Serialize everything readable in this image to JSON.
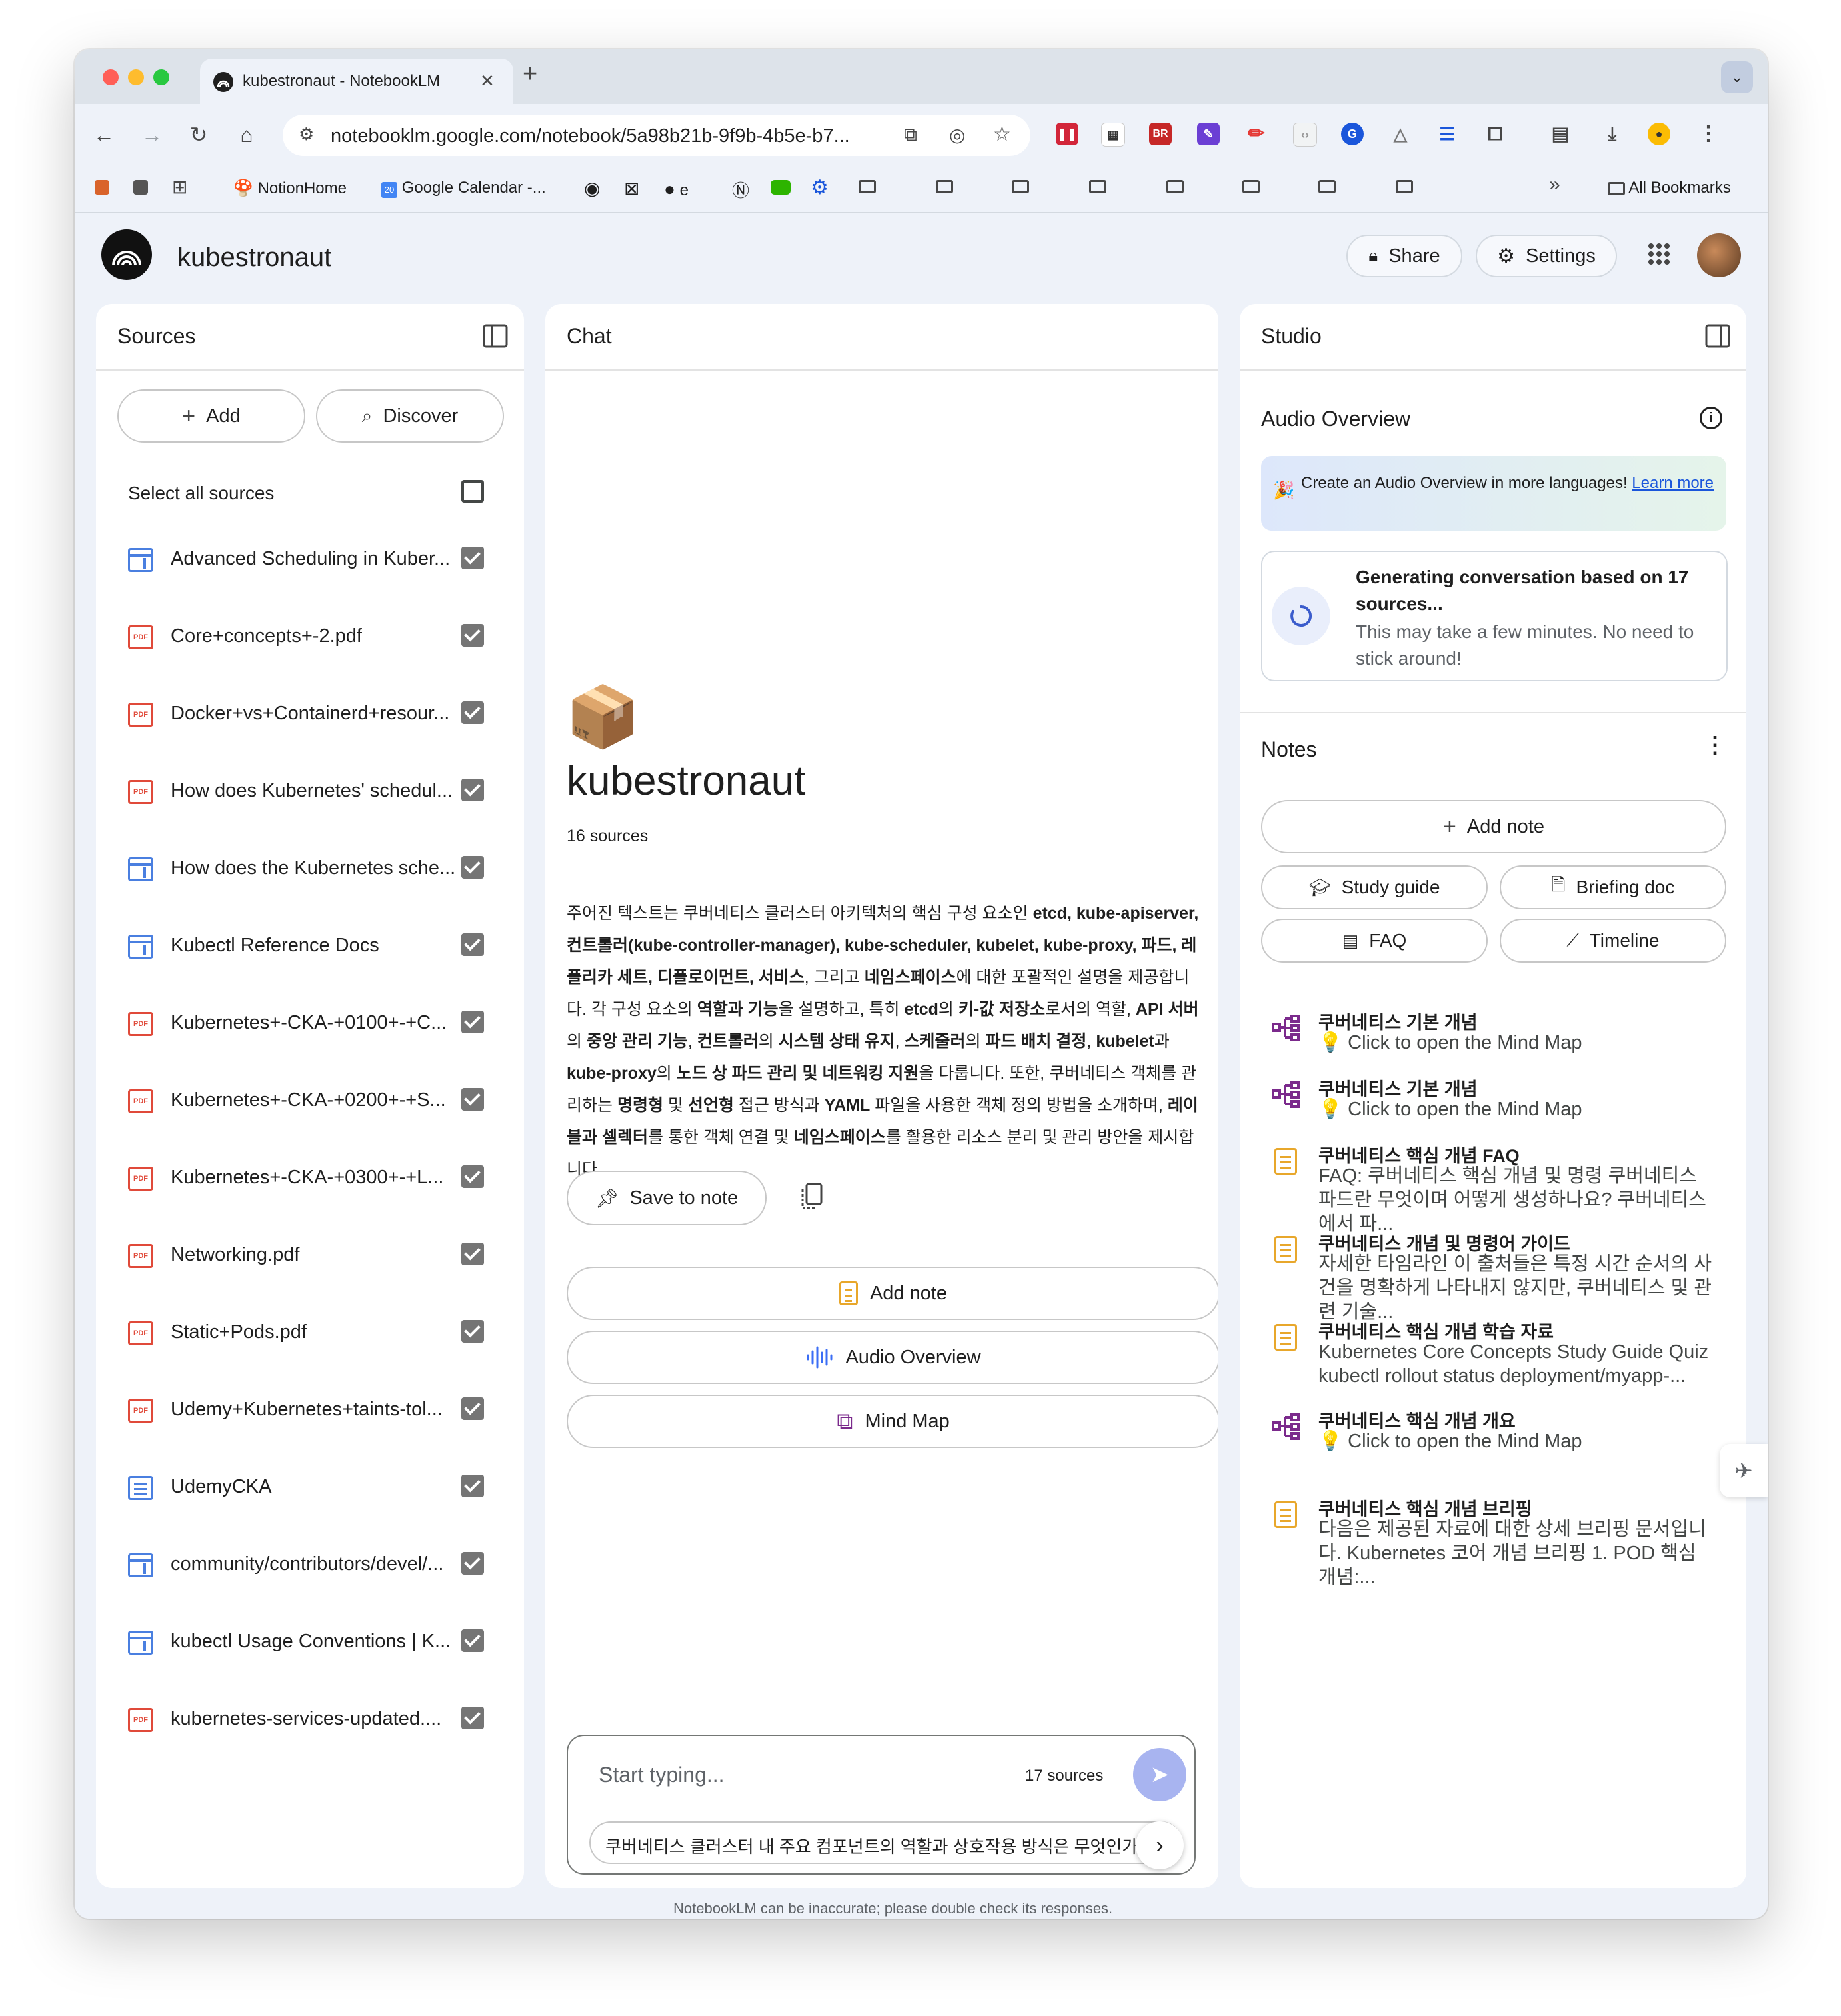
{
  "browser": {
    "tab_title": "kubestronaut - NotebookLM",
    "tab_close": "✕",
    "new_tab": "+",
    "url": "notebooklm.google.com/notebook/5a98b21b-9f9b-4b5e-b7...",
    "bookmarks": [
      {
        "label": "NotionHome"
      },
      {
        "label": "Google Calendar -..."
      },
      {
        "label": "e"
      },
      {
        "label": "All Bookmarks"
      }
    ],
    "overflow": "»"
  },
  "app": {
    "title": "kubestronaut",
    "share_label": "Share",
    "settings_label": "Settings"
  },
  "sources": {
    "title": "Sources",
    "add_label": "Add",
    "discover_label": "Discover",
    "select_all": "Select all sources",
    "items": [
      {
        "label": "Advanced Scheduling in Kuber...",
        "type": "web"
      },
      {
        "label": "Core+concepts+-2.pdf",
        "type": "pdf"
      },
      {
        "label": "Docker+vs+Containerd+resour...",
        "type": "pdf"
      },
      {
        "label": "How does Kubernetes' schedul...",
        "type": "pdf"
      },
      {
        "label": "How does the Kubernetes sche...",
        "type": "web"
      },
      {
        "label": "Kubectl Reference Docs",
        "type": "web"
      },
      {
        "label": "Kubernetes+-CKA-+0100+-+C...",
        "type": "pdf"
      },
      {
        "label": "Kubernetes+-CKA-+0200+-+S...",
        "type": "pdf"
      },
      {
        "label": "Kubernetes+-CKA-+0300+-+L...",
        "type": "pdf"
      },
      {
        "label": "Networking.pdf",
        "type": "pdf"
      },
      {
        "label": "Static+Pods.pdf",
        "type": "pdf"
      },
      {
        "label": "Udemy+Kubernetes+taints-tol...",
        "type": "pdf"
      },
      {
        "label": "UdemyCKA",
        "type": "doc"
      },
      {
        "label": "community/contributors/devel/...",
        "type": "web"
      },
      {
        "label": "kubectl Usage Conventions | K...",
        "type": "web"
      },
      {
        "label": "kubernetes-services-updated....",
        "type": "pdf"
      }
    ]
  },
  "chat": {
    "title": "Chat",
    "notebook_emoji": "📦",
    "notebook_title": "kubestronaut",
    "source_count": "16 sources",
    "summary_parts": [
      {
        "t": "주어진 텍스트는 쿠버네티스 클러스터 아키텍처의 핵심 구성 요소인 ",
        "b": false
      },
      {
        "t": "etcd, kube-apiserver, 컨트롤러(kube-controller-manager), kube-scheduler, kubelet, kube-proxy, 파드, 레플리카 세트, 디플로이먼트, 서비스",
        "b": true
      },
      {
        "t": ", 그리고 ",
        "b": false
      },
      {
        "t": "네임스페이스",
        "b": true
      },
      {
        "t": "에 대한 포괄적인 설명을 제공합니다. 각 구성 요소의 ",
        "b": false
      },
      {
        "t": "역할과 기능",
        "b": true
      },
      {
        "t": "을 설명하고, 특히 ",
        "b": false
      },
      {
        "t": "etcd",
        "b": true
      },
      {
        "t": "의 ",
        "b": false
      },
      {
        "t": "키-값 저장소",
        "b": true
      },
      {
        "t": "로서의 역할, ",
        "b": false
      },
      {
        "t": "API 서버",
        "b": true
      },
      {
        "t": "의 ",
        "b": false
      },
      {
        "t": "중앙 관리 기능",
        "b": true
      },
      {
        "t": ", ",
        "b": false
      },
      {
        "t": "컨트롤러",
        "b": true
      },
      {
        "t": "의 ",
        "b": false
      },
      {
        "t": "시스템 상태 유지",
        "b": true
      },
      {
        "t": ", ",
        "b": false
      },
      {
        "t": "스케줄러",
        "b": true
      },
      {
        "t": "의 ",
        "b": false
      },
      {
        "t": "파드 배치 결정",
        "b": true
      },
      {
        "t": ", ",
        "b": false
      },
      {
        "t": "kubelet",
        "b": true
      },
      {
        "t": "과 ",
        "b": false
      },
      {
        "t": "kube-proxy",
        "b": true
      },
      {
        "t": "의 ",
        "b": false
      },
      {
        "t": "노드 상 파드 관리 및 네트워킹 지원",
        "b": true
      },
      {
        "t": "을 다룹니다. 또한, 쿠버네티스 객체를 관리하는 ",
        "b": false
      },
      {
        "t": "명령형",
        "b": true
      },
      {
        "t": " 및 ",
        "b": false
      },
      {
        "t": "선언형",
        "b": true
      },
      {
        "t": " 접근 방식과 ",
        "b": false
      },
      {
        "t": "YAML",
        "b": true
      },
      {
        "t": " 파일을 사용한 객체 정의 방법을 소개하며, ",
        "b": false
      },
      {
        "t": "레이블과 셀렉터",
        "b": true
      },
      {
        "t": "를 통한 객체 연결 및 ",
        "b": false
      },
      {
        "t": "네임스페이스",
        "b": true
      },
      {
        "t": "를 활용한 리소스 분리 및 관리 방안을 제시합니다.",
        "b": false
      }
    ],
    "save_to_note": "Save to note",
    "add_note": "Add note",
    "audio_overview": "Audio Overview",
    "mind_map": "Mind Map",
    "input_placeholder": "Start typing...",
    "input_sources": "17 sources",
    "suggestion": "쿠버네티스 클러스터 내 주요 컴포넌트의 역할과 상호작용 방식은 무엇인가요?"
  },
  "studio": {
    "title": "Studio",
    "audio_title": "Audio Overview",
    "banner_emoji": "🎉",
    "banner_text": "Create an Audio Overview in more languages! ",
    "banner_link": "Learn more",
    "gen_title": "Generating conversation based on 17 sources...",
    "gen_sub": "This may take a few minutes. No need to stick around!",
    "notes_title": "Notes",
    "add_note": "Add note",
    "study_guide": "Study guide",
    "briefing_doc": "Briefing doc",
    "faq": "FAQ",
    "timeline": "Timeline",
    "notes": [
      {
        "type": "mindmap",
        "title": "쿠버네티스 기본 개념",
        "sub": "💡 Click to open the Mind Map"
      },
      {
        "type": "mindmap",
        "title": "쿠버네티스 기본 개념",
        "sub": "💡 Click to open the Mind Map"
      },
      {
        "type": "doc",
        "title": "쿠버네티스 핵심 개념 FAQ",
        "sub": "FAQ: 쿠버네티스 핵심 개념 및 명령 쿠버네티스 파드란 무엇이며 어떻게 생성하나요? 쿠버네티스에서 파..."
      },
      {
        "type": "doc",
        "title": "쿠버네티스 개념 및 명령어 가이드",
        "sub": "자세한 타임라인 이 출처들은 특정 시간 순서의 사건을 명확하게 나타내지 않지만, 쿠버네티스 및 관련 기술..."
      },
      {
        "type": "doc",
        "title": "쿠버네티스 핵심 개념 학습 자료",
        "sub": "Kubernetes Core Concepts Study Guide Quiz kubectl rollout status deployment/myapp-..."
      },
      {
        "type": "mindmap",
        "title": "쿠버네티스 핵심 개념 개요",
        "sub": "💡 Click to open the Mind Map"
      },
      {
        "type": "doc",
        "title": "쿠버네티스 핵심 개념 브리핑",
        "sub": "다음은 제공된 자료에 대한 상세 브리핑 문서입니다. Kubernetes 코어 개념 브리핑 1. POD 핵심 개념:..."
      }
    ]
  },
  "footer": "NotebookLM can be inaccurate; please double check its responses."
}
